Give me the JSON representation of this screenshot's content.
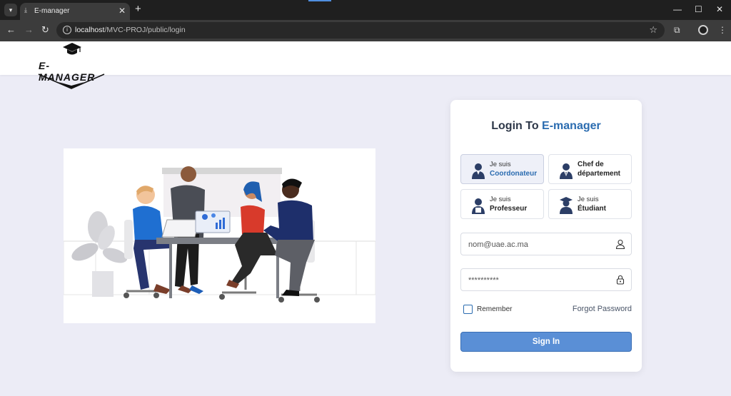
{
  "browser": {
    "tab_title": "E-manager",
    "tab_close": "✕",
    "new_tab": "+",
    "url_host": "localhost",
    "url_path": "/MVC-PROJ/public/login",
    "window_controls": {
      "minimize": "—",
      "maximize": "☐",
      "close": "✕"
    }
  },
  "header": {
    "logo_text": "E-MANAGER"
  },
  "login": {
    "title_prefix": "Login To ",
    "title_accent": "E-manager",
    "roles": [
      {
        "line1": "Je suis",
        "line2": "Coordonateur",
        "selected": true
      },
      {
        "line1": "Chef de",
        "line2": "département",
        "selected": false
      },
      {
        "line1": "Je suis",
        "line2": "Professeur",
        "selected": false
      },
      {
        "line1": "Je suis",
        "line2": "Étudiant",
        "selected": false
      }
    ],
    "email_placeholder": "nom@uae.ac.ma",
    "password_value": "**********",
    "remember_label": "Remember",
    "forgot_label": "Forgot Password",
    "signin_label": "Sign In"
  },
  "colors": {
    "accent": "#2b6cb0",
    "button": "#5a8fd6",
    "page_bg": "#ececf6"
  }
}
